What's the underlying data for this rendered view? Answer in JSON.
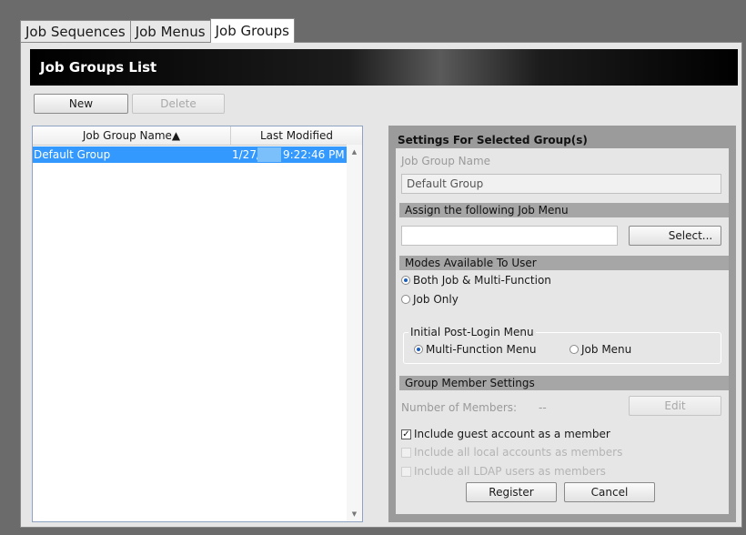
{
  "tabs": [
    {
      "label": "Job Sequences"
    },
    {
      "label": "Job Menus"
    },
    {
      "label": "Job Groups"
    }
  ],
  "header": {
    "title": "Job Groups List"
  },
  "toolbar": {
    "new_label": "New",
    "delete_label": "Delete"
  },
  "list": {
    "columns": [
      "Job Group Name▲",
      "Last Modified"
    ],
    "rows": [
      {
        "name": "Default Group",
        "modified": "1/27/",
        "modified_time": "9:22:46 PM"
      }
    ],
    "scroll_up": "▲",
    "scroll_down": "▼"
  },
  "settings": {
    "title": "Settings For Selected Group(s)",
    "job_group_name_label": "Job Group Name",
    "job_group_name_value": "Default Group",
    "assign_menu_header": "Assign the following Job Menu",
    "assign_menu_value": "",
    "select_label": "Select...",
    "modes_header": "Modes Available To User",
    "mode_options": [
      {
        "label": "Both Job & Multi-Function",
        "selected": true
      },
      {
        "label": "Job Only",
        "selected": false
      }
    ],
    "initial_menu_legend": "Initial Post-Login Menu",
    "initial_menu_options": [
      {
        "label": "Multi-Function Menu",
        "selected": true
      },
      {
        "label": "Job Menu",
        "selected": false
      }
    ],
    "member_settings_header": "Group Member Settings",
    "members_label": "Number of Members:",
    "members_value": "--",
    "edit_label": "Edit",
    "checkboxes": [
      {
        "label": "Include guest account as a member",
        "checked": true,
        "enabled": true
      },
      {
        "label": "Include all local accounts as members",
        "checked": false,
        "enabled": false
      },
      {
        "label": "Include all LDAP users as members",
        "checked": false,
        "enabled": false
      }
    ],
    "register_label": "Register",
    "cancel_label": "Cancel"
  },
  "check_glyph": "✓"
}
